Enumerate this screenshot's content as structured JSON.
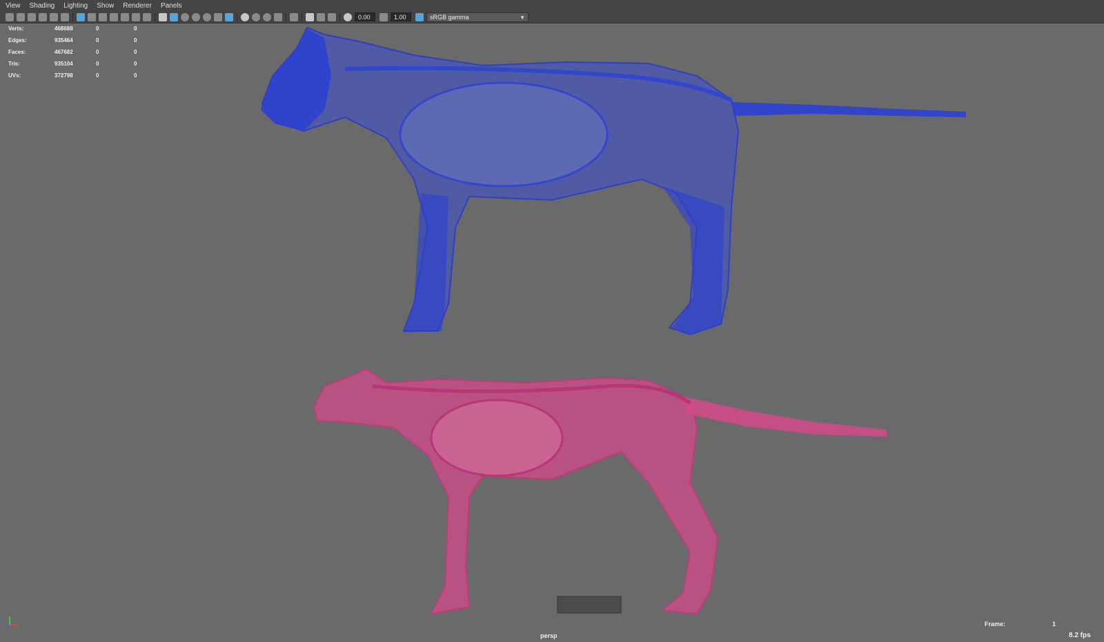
{
  "menu": [
    "View",
    "Shading",
    "Lighting",
    "Show",
    "Renderer",
    "Panels"
  ],
  "toolbar": {
    "field_a": "0.00",
    "field_b": "1.00",
    "colorspace": "sRGB gamma"
  },
  "hud": {
    "rows": [
      {
        "label": "Verts:",
        "v1": "468688",
        "v2": "0",
        "v3": "0"
      },
      {
        "label": "Edges:",
        "v1": "935464",
        "v2": "0",
        "v3": "0"
      },
      {
        "label": "Faces:",
        "v1": "467682",
        "v2": "0",
        "v3": "0"
      },
      {
        "label": "Tris:",
        "v1": "935104",
        "v2": "0",
        "v3": "0"
      },
      {
        "label": "UVs:",
        "v1": "372798",
        "v2": "0",
        "v3": "0"
      }
    ]
  },
  "status": {
    "frame_label": "Frame:",
    "frame_value": "1",
    "fps": "8.2 fps",
    "camera": "persp"
  },
  "colors": {
    "viewport_bg": "#6a6a6a",
    "blue_model": "#2f45e0",
    "pink_model": "#e0458e"
  }
}
